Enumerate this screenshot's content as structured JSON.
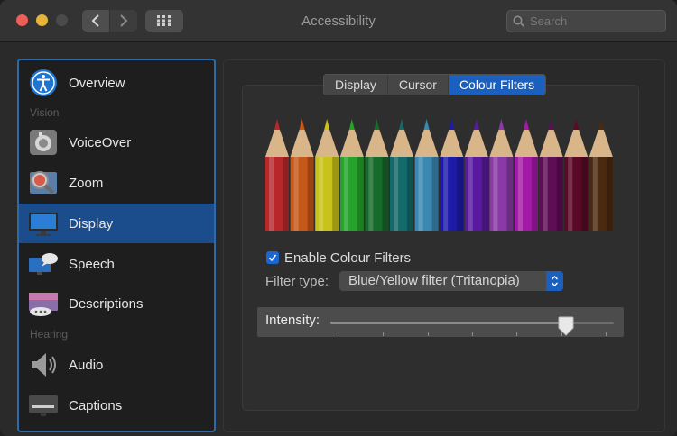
{
  "window": {
    "title": "Accessibility"
  },
  "search": {
    "placeholder": "Search"
  },
  "sidebar": {
    "items": [
      {
        "label": "Overview",
        "icon": "overview-icon"
      },
      {
        "label": "VoiceOver",
        "icon": "voiceover-icon"
      },
      {
        "label": "Zoom",
        "icon": "zoom-icon"
      },
      {
        "label": "Display",
        "icon": "display-icon",
        "selected": true
      },
      {
        "label": "Speech",
        "icon": "speech-icon"
      },
      {
        "label": "Descriptions",
        "icon": "descriptions-icon"
      },
      {
        "label": "Audio",
        "icon": "audio-icon"
      },
      {
        "label": "Captions",
        "icon": "captions-icon"
      }
    ],
    "sections": {
      "vision": "Vision",
      "hearing": "Hearing"
    }
  },
  "tabs": [
    {
      "label": "Display"
    },
    {
      "label": "Cursor"
    },
    {
      "label": "Colour Filters",
      "active": true
    }
  ],
  "colour_filters": {
    "enable_label": "Enable Colour Filters",
    "enabled": true,
    "filter_type_label": "Filter type:",
    "filter_type_value": "Blue/Yellow filter (Tritanopia)",
    "intensity_label": "Intensity:",
    "intensity_value": 0.83,
    "pencil_colors": [
      "#b8282a",
      "#c6581a",
      "#c8c21a",
      "#25a32a",
      "#166a2a",
      "#146a6a",
      "#3b89b3",
      "#1d1aa8",
      "#5a1aa0",
      "#8a3aa6",
      "#a31aa6",
      "#5e0e55",
      "#5a0a26",
      "#4b2a10"
    ]
  },
  "colors": {
    "accent": "#1b5fbf",
    "sidebar_border": "#2f6aa5"
  }
}
